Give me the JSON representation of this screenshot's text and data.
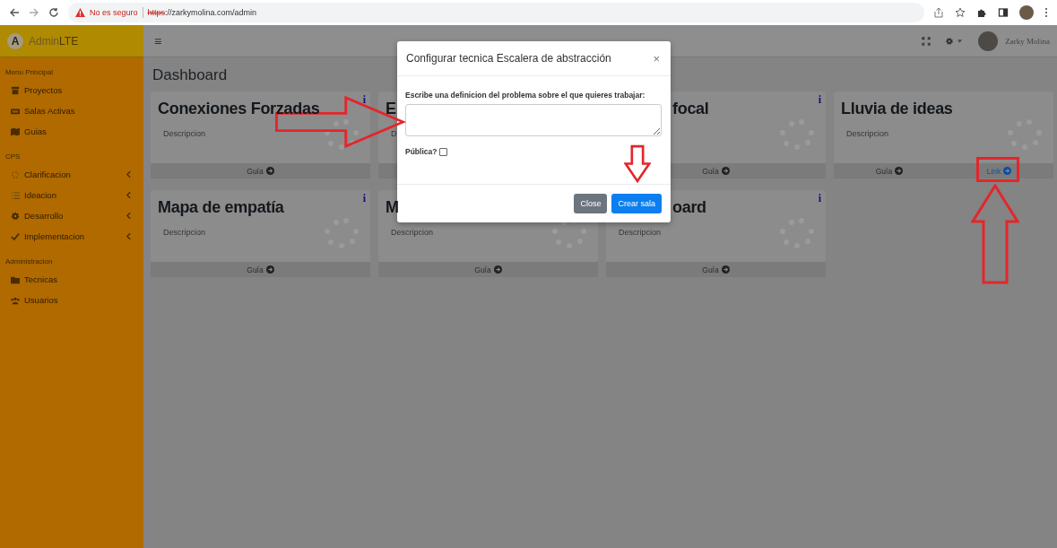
{
  "browser": {
    "security": "No es seguro",
    "scheme": "https",
    "url": "://zarkymolina.com/admin"
  },
  "brand": {
    "letter": "A",
    "name": "Admin",
    "name_light": "LTE"
  },
  "sidebar": [
    {
      "kind": "header",
      "label": "Menu Principal"
    },
    {
      "kind": "item",
      "label": "Proyectos"
    },
    {
      "kind": "item",
      "label": "Salas Activas"
    },
    {
      "kind": "item",
      "label": "Guias"
    },
    {
      "kind": "header",
      "label": "CPS"
    },
    {
      "kind": "group",
      "label": "Clarificacion",
      "expanded": false
    },
    {
      "kind": "group",
      "label": "Ideacion",
      "expanded": false
    },
    {
      "kind": "group",
      "label": "Desarrollo",
      "expanded": false
    },
    {
      "kind": "group",
      "label": "Implementacion",
      "expanded": false
    },
    {
      "kind": "header",
      "label": "Administracion"
    },
    {
      "kind": "item",
      "label": "Tecnicas"
    },
    {
      "kind": "item",
      "label": "Usuarios"
    }
  ],
  "topbar": {
    "menu_glyph": "≡",
    "user": "Zarky Molina"
  },
  "page_title": "Dashboard",
  "cards": [
    {
      "title": "Conexiones Forzadas",
      "info": "i",
      "description": "Descripcion",
      "footer": [
        "Guía"
      ]
    },
    {
      "title": "E",
      "description": "D"
    },
    {
      "title": "focal",
      "info": "i",
      "footer": [
        "Guía"
      ]
    },
    {
      "title": "Lluvia de ideas",
      "description": "Descripcion",
      "footer": [
        "Guía",
        "Link"
      ]
    },
    {
      "title": "Mapa de empatía",
      "info": "i",
      "description": "Descripcion",
      "footer": [
        "Guía"
      ]
    },
    {
      "title": "M",
      "description": "Descripcion",
      "footer": [
        "Guía"
      ]
    },
    {
      "title": "oard",
      "info": "i",
      "description": "Descripcion",
      "footer": [
        "Guía"
      ]
    }
  ],
  "modal": {
    "title": "Configurar tecnica Escalera de abstracción",
    "close_glyph": "×",
    "label": "Escribe una definicion del problema sobre el que quieres trabajar:",
    "public_label": "Pública?",
    "public_checked": false,
    "buttons": [
      {
        "kind": "secondary",
        "label": "Close"
      },
      {
        "kind": "primary",
        "label": "Crear sala"
      }
    ]
  }
}
